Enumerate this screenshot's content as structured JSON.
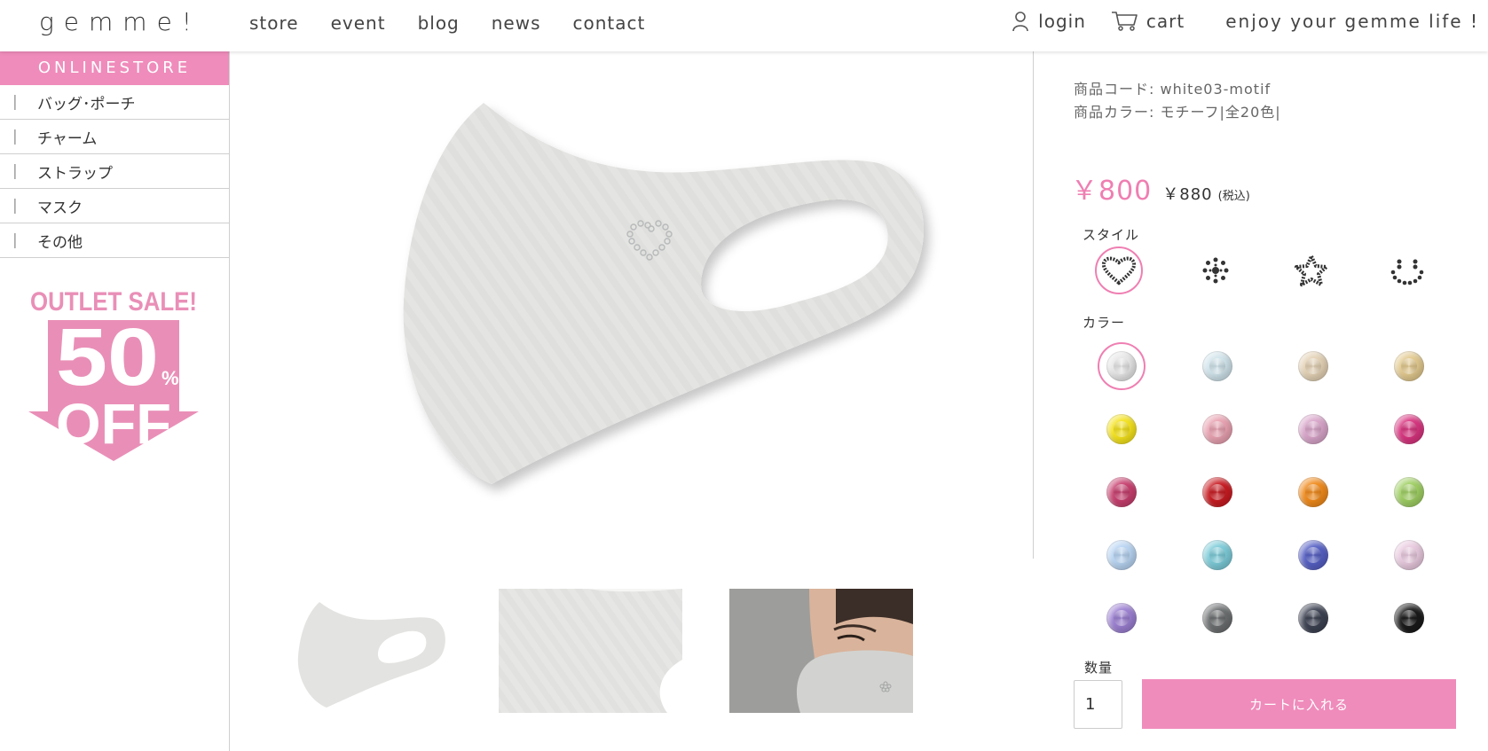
{
  "header": {
    "logo": "gemme!",
    "nav": [
      "store",
      "event",
      "blog",
      "news",
      "contact"
    ],
    "login_label": "login",
    "cart_label": "cart",
    "tagline": "enjoy your gemme life !"
  },
  "sidebar": {
    "title": "ONLINESTORE",
    "items": [
      {
        "bar": "|",
        "label": "バッグ･ポーチ"
      },
      {
        "bar": "|",
        "label": "チャーム"
      },
      {
        "bar": "|",
        "label": "ストラップ"
      },
      {
        "bar": "|",
        "label": "マスク"
      },
      {
        "bar": "|",
        "label": "その他"
      }
    ],
    "banner": {
      "line1": "OUTLET SALE!",
      "line2": "50",
      "percent": "%",
      "line3": "OFF"
    }
  },
  "product": {
    "code_label": "商品コード:",
    "code": "white03-motif",
    "color_label": "商品カラー:",
    "color": "モチーフ|全20色|",
    "price": "￥800",
    "price_tax": "￥880",
    "price_tax_note": "(税込)",
    "style_label": "スタイル",
    "styles": [
      "heart-motif",
      "snowflake-motif",
      "star-motif",
      "smile-motif"
    ],
    "color_section_label": "カラー",
    "colors": [
      "#e6e6e6",
      "#cfe3ea",
      "#e3d1b4",
      "#e2c98e",
      "#f4e21c",
      "#e8a1b0",
      "#d8a4c9",
      "#d8357f",
      "#c73f6e",
      "#c81c22",
      "#f08a1b",
      "#9fcf63",
      "#b8d4f2",
      "#7ccbd8",
      "#5660c4",
      "#e8c9de",
      "#9b7fd1",
      "#6c6f70",
      "#3d4252",
      "#1a1a1a"
    ],
    "qty_label": "数量",
    "qty_value": "1",
    "cart_button": "カートに入れる"
  },
  "colors": {
    "accent": "#ef8cbb",
    "price": "#ef7fb2"
  }
}
